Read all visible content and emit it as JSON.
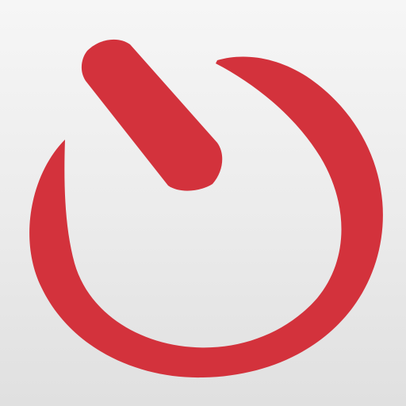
{
  "icon": {
    "name": "power-timer-icon",
    "accent_color": "#d3323c",
    "background_color": "#ececec"
  }
}
